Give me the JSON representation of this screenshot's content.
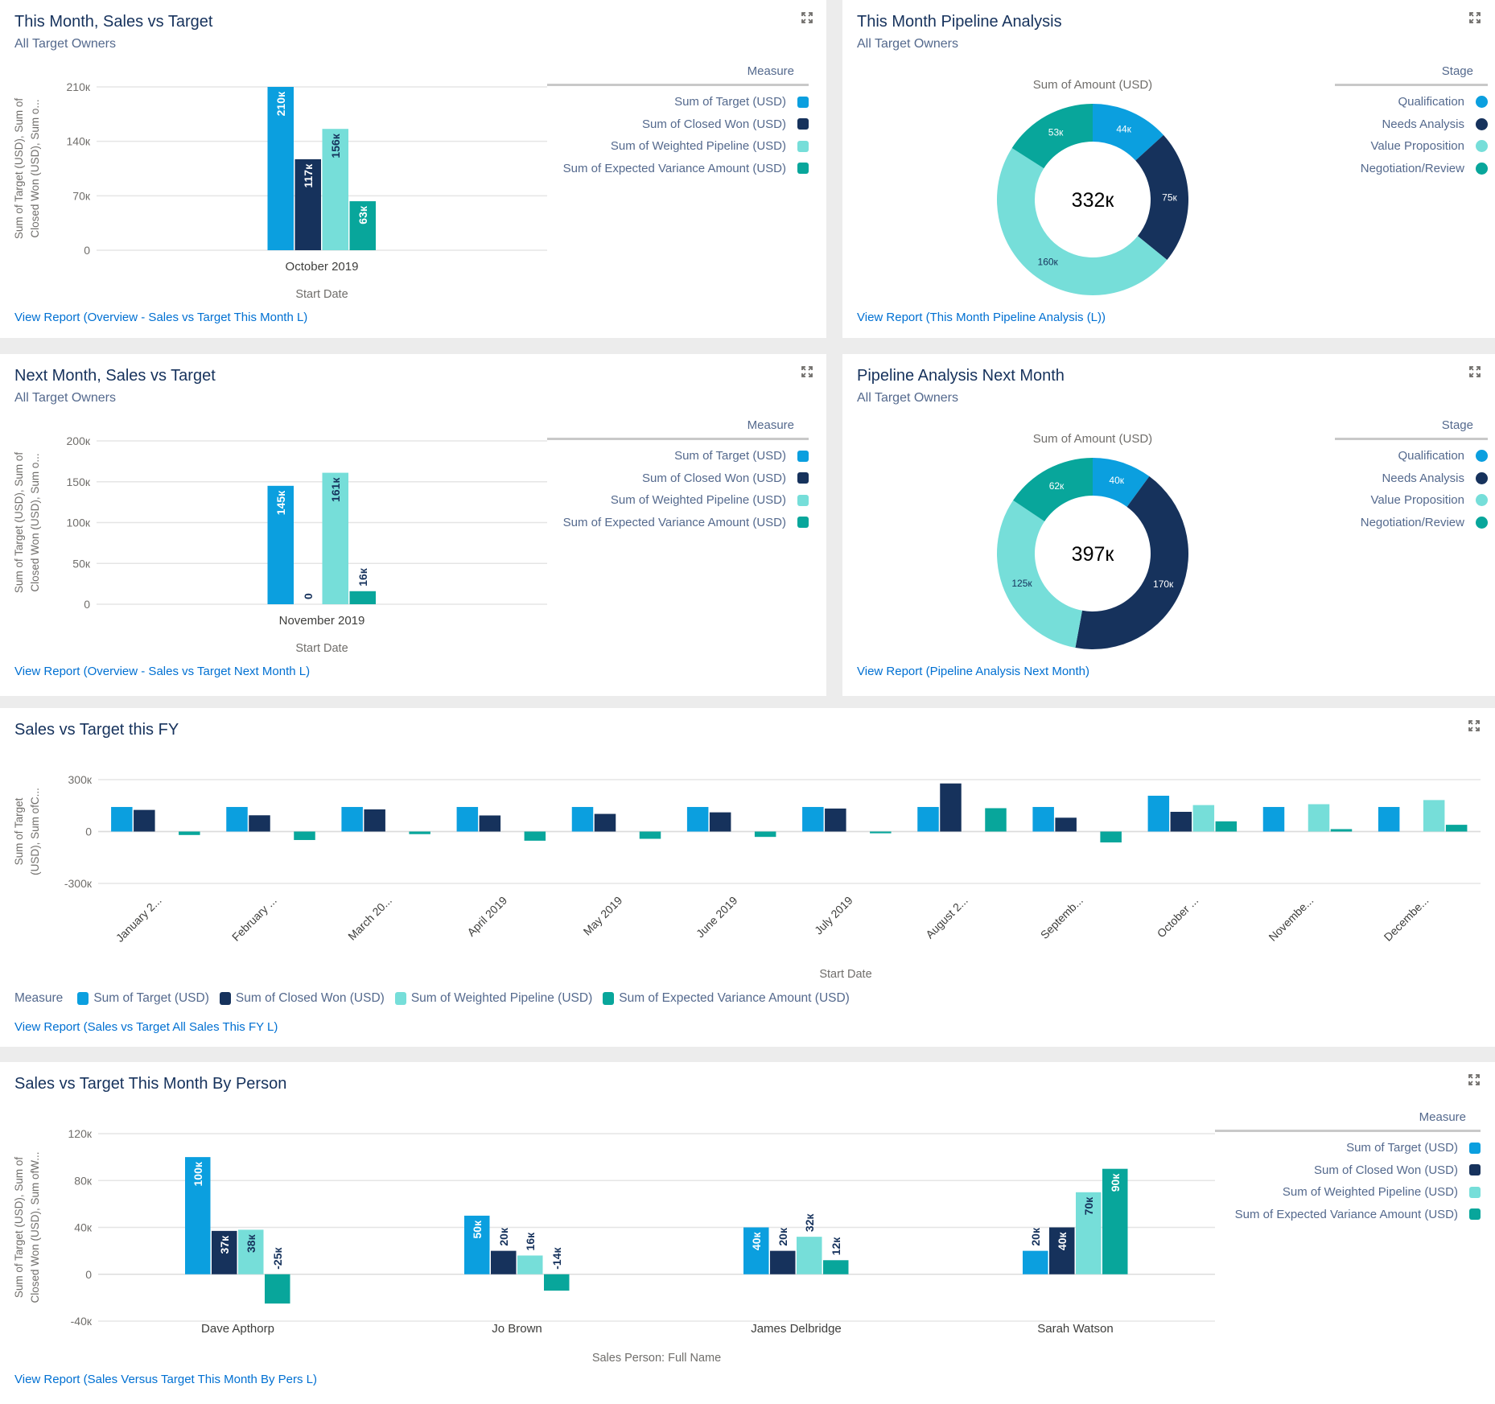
{
  "colors": {
    "target": "#0b9fdf",
    "closed_won": "#16325c",
    "weighted_pipeline": "#76ded9",
    "expected_variance": "#08a69b",
    "qualification": "#0b9fdf",
    "needs_analysis": "#16325c",
    "value_proposition": "#76ded9",
    "negotiation_review": "#08a69b",
    "link": "#0070d2"
  },
  "measure_legend": {
    "title": "Measure",
    "items": [
      {
        "label": "Sum of Target (USD)",
        "key": "target"
      },
      {
        "label": "Sum of Closed Won (USD)",
        "key": "closed_won"
      },
      {
        "label": "Sum of Weighted Pipeline (USD)",
        "key": "weighted_pipeline"
      },
      {
        "label": "Sum of Expected Variance Amount (USD)",
        "key": "expected_variance"
      }
    ]
  },
  "stage_legend": {
    "title": "Stage",
    "items": [
      {
        "label": "Qualification",
        "key": "qualification"
      },
      {
        "label": "Needs Analysis",
        "key": "needs_analysis"
      },
      {
        "label": "Value Proposition",
        "key": "value_proposition"
      },
      {
        "label": "Negotiation/Review",
        "key": "negotiation_review"
      }
    ]
  },
  "panels": {
    "this_month": {
      "title": "This Month, Sales vs Target",
      "subtitle": "All Target Owners",
      "link": "View Report (Overview - Sales vs Target This Month L)",
      "expand_icon": "expand-icon"
    },
    "this_month_pipeline": {
      "title": "This Month Pipeline Analysis",
      "subtitle": "All Target Owners",
      "link": "View Report (This Month Pipeline Analysis (L))",
      "expand_icon": "expand-icon"
    },
    "next_month": {
      "title": "Next Month, Sales vs Target",
      "subtitle": "All Target Owners",
      "link": "View Report (Overview - Sales vs Target Next Month L)",
      "expand_icon": "expand-icon"
    },
    "next_month_pipeline": {
      "title": "Pipeline Analysis Next Month",
      "subtitle": "All Target Owners",
      "link": "View Report (Pipeline Analysis Next Month)",
      "expand_icon": "expand-icon"
    },
    "fy": {
      "title": "Sales vs Target this FY",
      "link": "View Report (Sales vs Target All Sales This FY L)",
      "expand_icon": "expand-icon"
    },
    "by_person": {
      "title": "Sales vs Target This Month By Person",
      "link": "View Report (Sales Versus Target This Month By Pers L)",
      "expand_icon": "expand-icon"
    }
  },
  "chart_data": [
    {
      "id": "this_month",
      "type": "bar",
      "title": "This Month, Sales vs Target",
      "xlabel": "Start Date",
      "ylabel": "Sum of Target (USD), Sum of Closed Won (USD), Sum o...",
      "ylabel_lines": [
        "Sum of Target (USD), Sum of",
        "Closed Won (USD), Sum o..."
      ],
      "categories": [
        "October 2019"
      ],
      "ylim": [
        0,
        210000
      ],
      "yticks": [
        0,
        70000,
        140000,
        210000
      ],
      "ytick_labels": [
        "0",
        "70к",
        "140к",
        "210к"
      ],
      "grid": true,
      "legend": "right",
      "series": [
        {
          "name": "Sum of Target (USD)",
          "key": "target",
          "values": [
            210000
          ],
          "labels": [
            "210к"
          ]
        },
        {
          "name": "Sum of Closed Won (USD)",
          "key": "closed_won",
          "values": [
            117000
          ],
          "labels": [
            "117к"
          ]
        },
        {
          "name": "Sum of Weighted Pipeline (USD)",
          "key": "weighted_pipeline",
          "values": [
            156000
          ],
          "labels": [
            "156к"
          ]
        },
        {
          "name": "Sum of Expected Variance Amount (USD)",
          "key": "expected_variance",
          "values": [
            63000
          ],
          "labels": [
            "63к"
          ]
        }
      ]
    },
    {
      "id": "this_month_pipeline",
      "type": "pie",
      "donut": true,
      "title": "Sum of Amount (USD)",
      "center_label": "332к",
      "legend": "right",
      "slices": [
        {
          "name": "Qualification",
          "key": "qualification",
          "value": 44000,
          "label": "44к"
        },
        {
          "name": "Needs Analysis",
          "key": "needs_analysis",
          "value": 75000,
          "label": "75к"
        },
        {
          "name": "Value Proposition",
          "key": "value_proposition",
          "value": 160000,
          "label": "160к"
        },
        {
          "name": "Negotiation/Review",
          "key": "negotiation_review",
          "value": 53000,
          "label": "53к"
        }
      ]
    },
    {
      "id": "next_month",
      "type": "bar",
      "title": "Next Month, Sales vs Target",
      "xlabel": "Start Date",
      "ylabel": "Sum of Target (USD), Sum of Closed Won (USD), Sum o...",
      "ylabel_lines": [
        "Sum of Target (USD), Sum of",
        "Closed Won (USD), Sum o..."
      ],
      "categories": [
        "November 2019"
      ],
      "ylim": [
        0,
        200000
      ],
      "yticks": [
        0,
        50000,
        100000,
        150000,
        200000
      ],
      "ytick_labels": [
        "0",
        "50к",
        "100к",
        "150к",
        "200к"
      ],
      "grid": true,
      "legend": "right",
      "series": [
        {
          "name": "Sum of Target (USD)",
          "key": "target",
          "values": [
            145000
          ],
          "labels": [
            "145к"
          ]
        },
        {
          "name": "Sum of Closed Won (USD)",
          "key": "closed_won",
          "values": [
            0
          ],
          "labels": [
            "0"
          ]
        },
        {
          "name": "Sum of Weighted Pipeline (USD)",
          "key": "weighted_pipeline",
          "values": [
            161000
          ],
          "labels": [
            "161к"
          ]
        },
        {
          "name": "Sum of Expected Variance Amount (USD)",
          "key": "expected_variance",
          "values": [
            16000
          ],
          "labels": [
            "16к"
          ]
        }
      ]
    },
    {
      "id": "next_month_pipeline",
      "type": "pie",
      "donut": true,
      "title": "Sum of Amount (USD)",
      "center_label": "397к",
      "legend": "right",
      "slices": [
        {
          "name": "Qualification",
          "key": "qualification",
          "value": 40000,
          "label": "40к"
        },
        {
          "name": "Needs Analysis",
          "key": "needs_analysis",
          "value": 170000,
          "label": "170к"
        },
        {
          "name": "Value Proposition",
          "key": "value_proposition",
          "value": 125000,
          "label": "125к"
        },
        {
          "name": "Negotiation/Review",
          "key": "negotiation_review",
          "value": 62000,
          "label": "62к"
        }
      ]
    },
    {
      "id": "fy",
      "type": "bar",
      "title": "Sales vs Target this FY",
      "xlabel": "Start Date",
      "ylabel": "Sum of Target (USD), Sum ofC...",
      "ylabel_lines": [
        "Sum of Target",
        "(USD), Sum ofC..."
      ],
      "categories": [
        "January 2...",
        "February ...",
        "March 20...",
        "April 2019",
        "May 2019",
        "June 2019",
        "July 2019",
        "August 2...",
        "Septemb...",
        "October ...",
        "Novembe...",
        "Decembe..."
      ],
      "ylim": [
        -300000,
        300000
      ],
      "yticks": [
        -300000,
        0,
        300000
      ],
      "ytick_labels": [
        "-300к",
        "0",
        "300к"
      ],
      "grid": true,
      "legend": "bottom",
      "series": [
        {
          "name": "Sum of Target (USD)",
          "key": "target",
          "values": [
            142000,
            142000,
            142000,
            142000,
            142000,
            142000,
            142000,
            142000,
            142000,
            207000,
            142000,
            142000
          ]
        },
        {
          "name": "Sum of Closed Won (USD)",
          "key": "closed_won",
          "values": [
            125000,
            94000,
            128000,
            93000,
            102000,
            111000,
            133000,
            278000,
            80000,
            114000,
            0,
            0
          ]
        },
        {
          "name": "Sum of Weighted Pipeline (USD)",
          "key": "weighted_pipeline",
          "values": [
            0,
            0,
            0,
            0,
            0,
            0,
            0,
            0,
            0,
            153000,
            158000,
            182000
          ]
        },
        {
          "name": "Sum of Expected Variance Amount (USD)",
          "key": "expected_variance",
          "values": [
            -20000,
            -49000,
            -15000,
            -53000,
            -42000,
            -31000,
            -10000,
            135000,
            -63000,
            59000,
            14000,
            39000
          ]
        }
      ]
    },
    {
      "id": "by_person",
      "type": "bar",
      "title": "Sales vs Target This Month By Person",
      "xlabel": "Sales Person: Full Name",
      "ylabel": "Sum of Target (USD), Sum of Closed Won (USD), Sum ofW...",
      "ylabel_lines": [
        "Sum of Target (USD), Sum of",
        "Closed Won (USD), Sum ofW..."
      ],
      "categories": [
        "Dave Apthorp",
        "Jo Brown",
        "James Delbridge",
        "Sarah Watson"
      ],
      "ylim": [
        -40000,
        120000
      ],
      "yticks": [
        -40000,
        0,
        40000,
        80000,
        120000
      ],
      "ytick_labels": [
        "-40к",
        "0",
        "40к",
        "80к",
        "120к"
      ],
      "grid": true,
      "legend": "right",
      "series": [
        {
          "name": "Sum of Target (USD)",
          "key": "target",
          "values": [
            100000,
            50000,
            40000,
            20000
          ],
          "labels": [
            "100к",
            "50к",
            "40к",
            "20к"
          ]
        },
        {
          "name": "Sum of Closed Won (USD)",
          "key": "closed_won",
          "values": [
            37000,
            20000,
            20000,
            40000
          ],
          "labels": [
            "37к",
            "20к",
            "20к",
            "40к"
          ]
        },
        {
          "name": "Sum of Weighted Pipeline (USD)",
          "key": "weighted_pipeline",
          "values": [
            38000,
            16000,
            32000,
            70000
          ],
          "labels": [
            "38к",
            "16к",
            "32к",
            "70к"
          ]
        },
        {
          "name": "Sum of Expected Variance Amount (USD)",
          "key": "expected_variance",
          "values": [
            -25000,
            -14000,
            12000,
            90000
          ],
          "labels": [
            "-25к",
            "-14к",
            "12к",
            "90к"
          ]
        }
      ]
    }
  ]
}
